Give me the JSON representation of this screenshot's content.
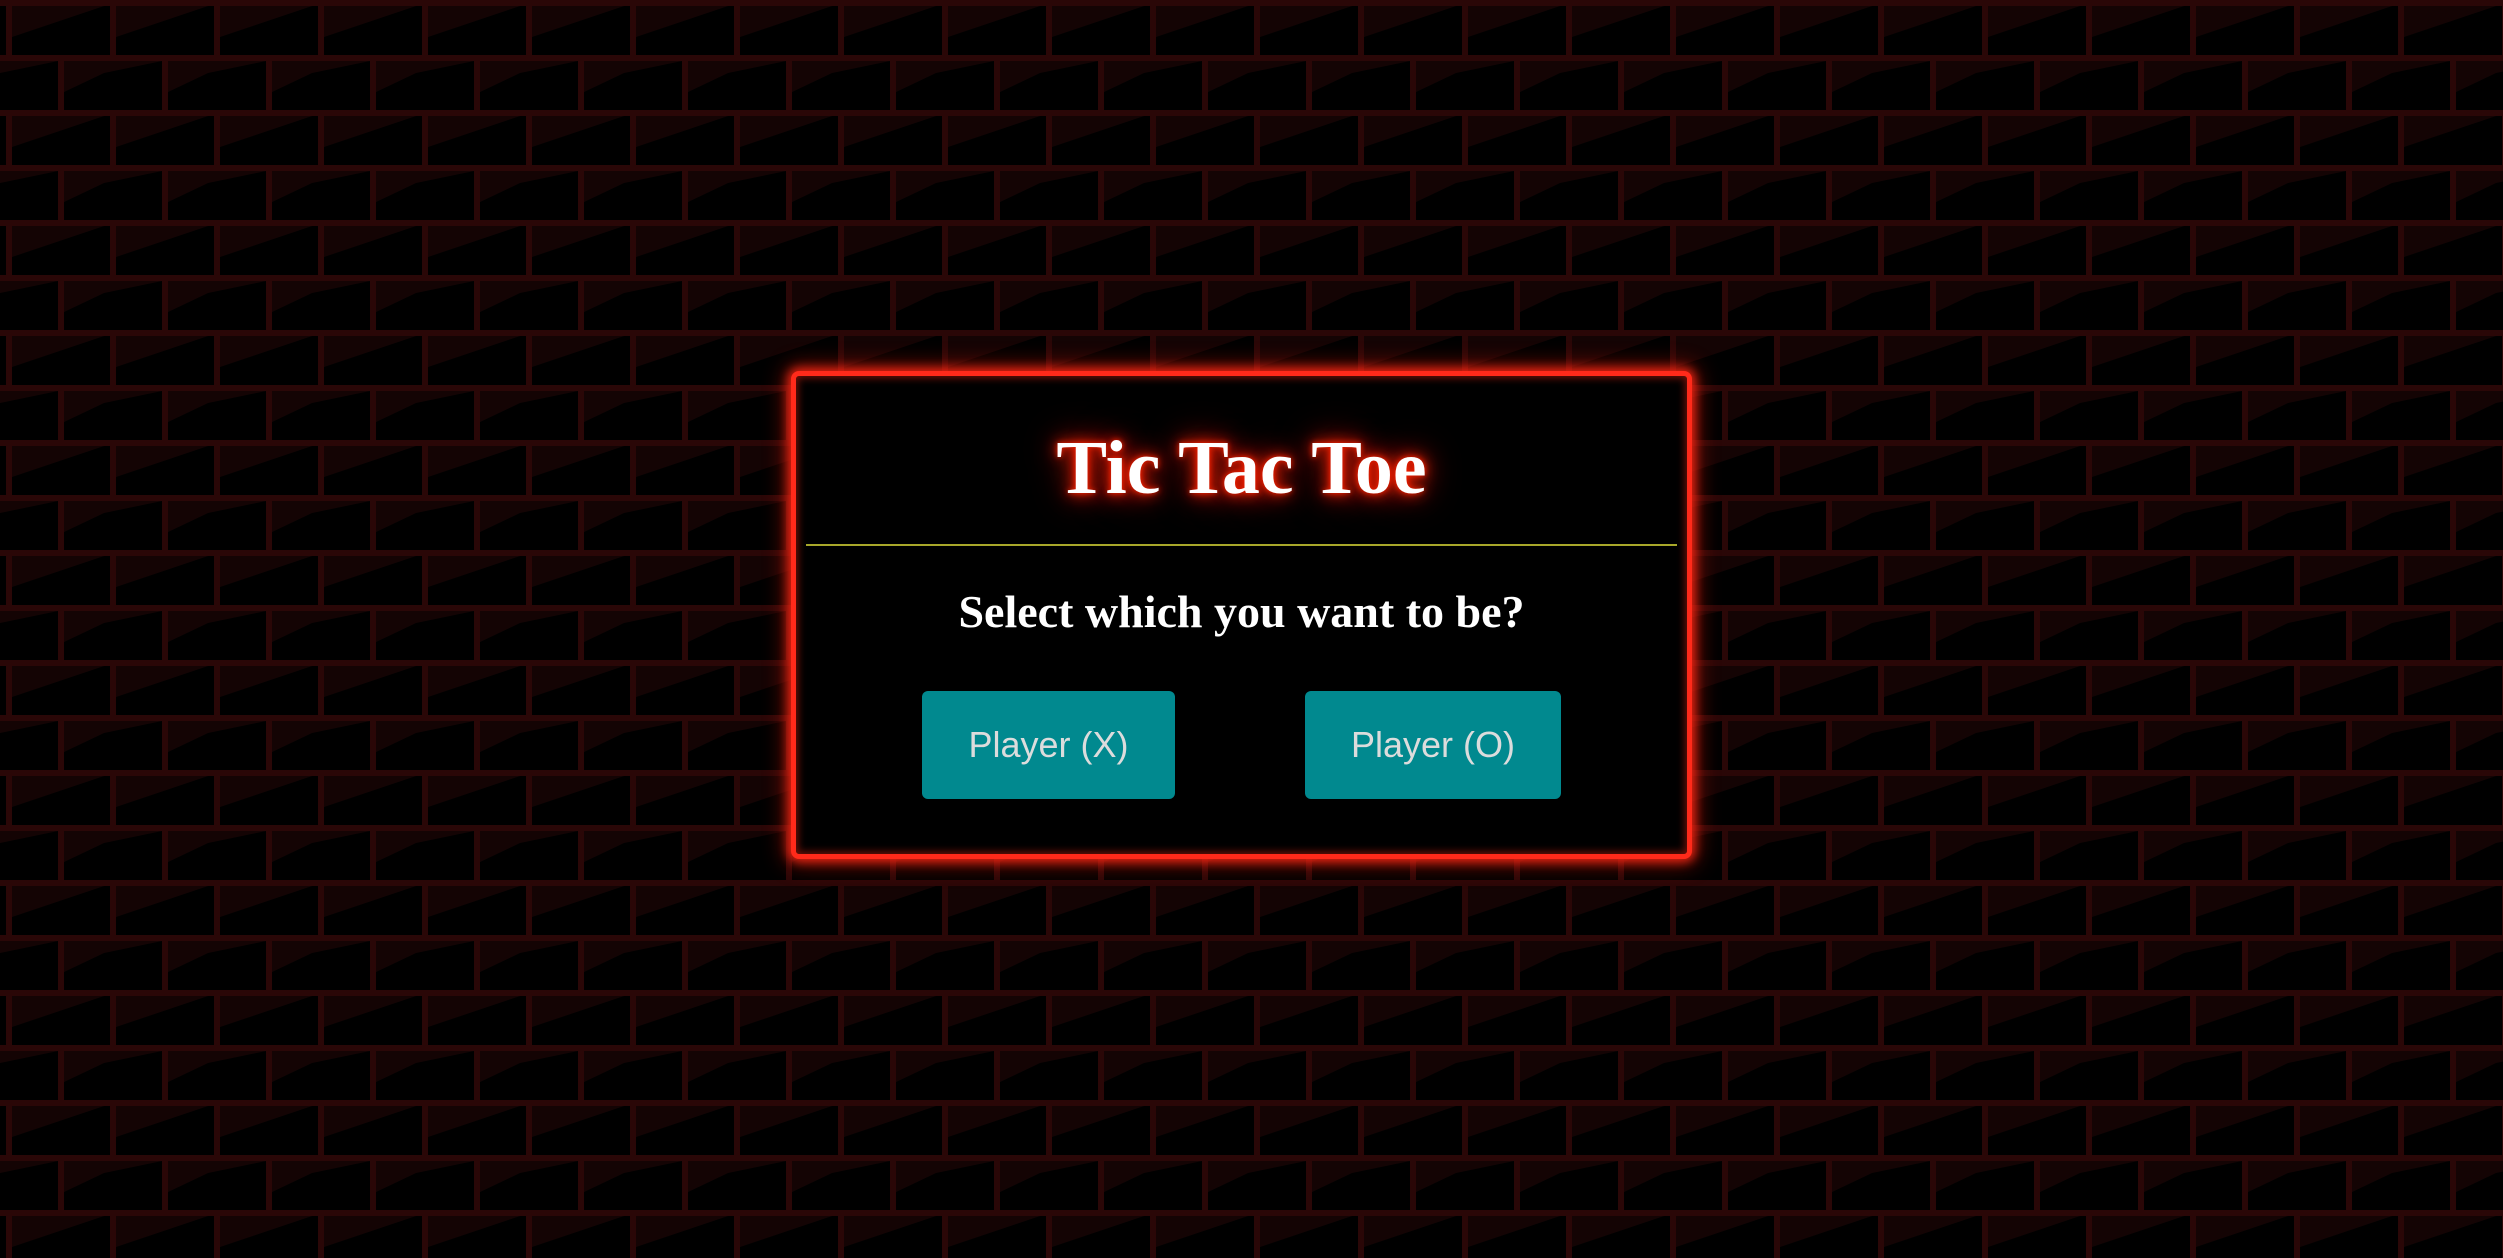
{
  "game": {
    "title": "Tic Tac Toe",
    "prompt": "Select which you want to be?"
  },
  "buttons": {
    "player_x": "Player (X)",
    "player_o": "Player (O)"
  },
  "colors": {
    "page_background": "#000000",
    "brick_mortar": "#2a0707",
    "brick_shade": "#140404",
    "dialog_border": "#ff2a1a",
    "title_glow": "#ff2200",
    "divider": "#a8a72a",
    "button_background": "#01898f",
    "button_text": "#dcdcdc"
  }
}
